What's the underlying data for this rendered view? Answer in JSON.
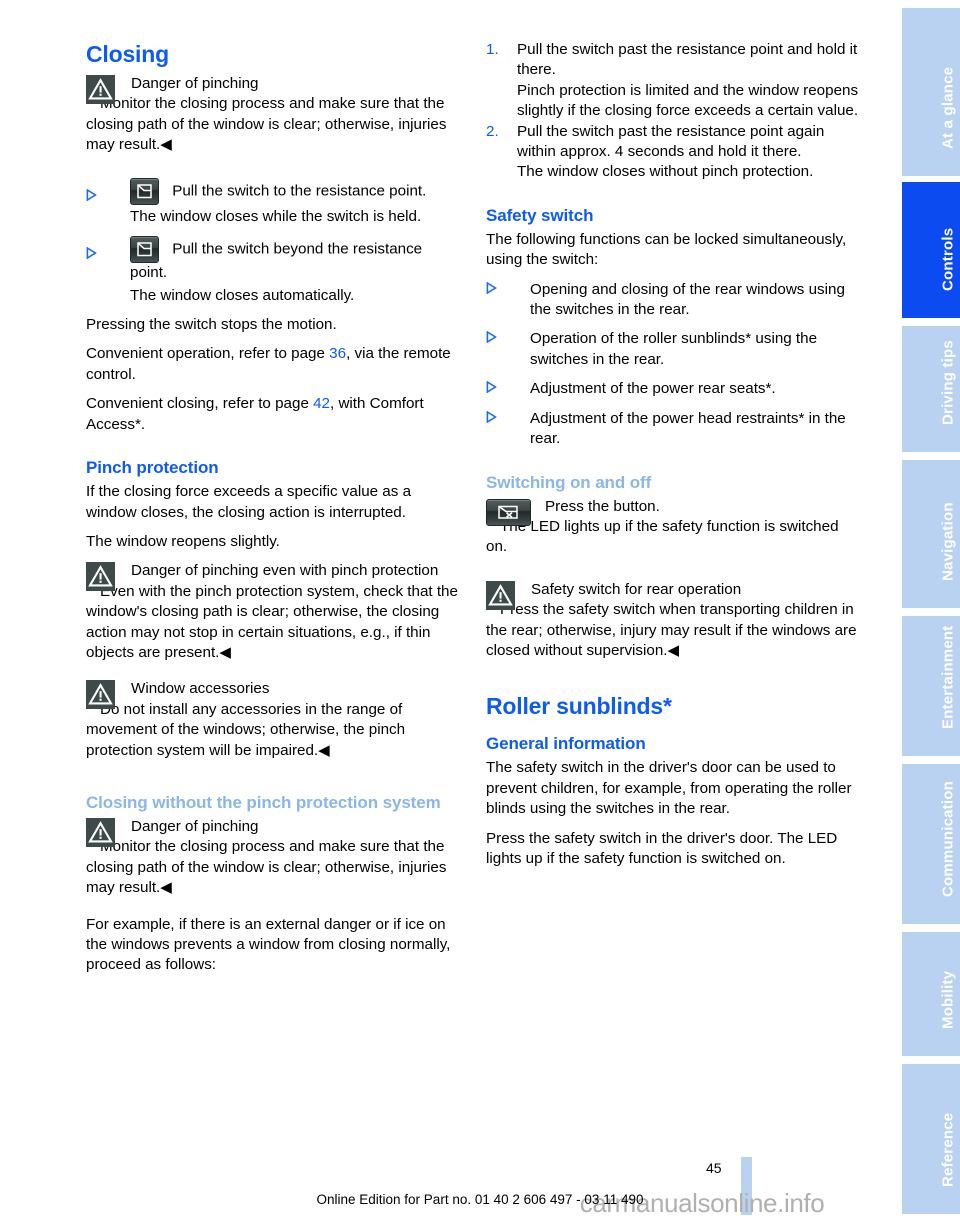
{
  "page": {
    "number": "45",
    "footer_text": "Online Edition for Part no. 01 40 2 606 497 - 03 11 490",
    "watermark": "carmanualsonline.info",
    "accent_blue": "#0c5bf5",
    "light_blue": "#8ab6e8",
    "tab_blue": "#b9d2f2",
    "tab_active_blue": "#0c4bf0"
  },
  "sidebar": {
    "tabs": [
      {
        "label": "At a glance",
        "active": false
      },
      {
        "label": "Controls",
        "active": true
      },
      {
        "label": "Driving tips",
        "active": false
      },
      {
        "label": "Navigation",
        "active": false
      },
      {
        "label": "Entertainment",
        "active": false
      },
      {
        "label": "Communication",
        "active": false
      },
      {
        "label": "Mobility",
        "active": false
      },
      {
        "label": "Reference",
        "active": false
      }
    ]
  },
  "left": {
    "closing": {
      "heading": "Closing",
      "warn1": {
        "icon": "warning-triangle-icon",
        "title": "Danger of pinching",
        "body": "Monitor the closing process and make sure that the closing path of the window is clear; otherwise, injuries may result.◀"
      },
      "step1": {
        "marker": "triangle-bullet-icon",
        "icon": "door-window-switch-icon",
        "text": "Pull the switch to the resistance point.",
        "result": "The window closes while the switch is held."
      },
      "step2": {
        "marker": "triangle-bullet-icon",
        "icon": "door-window-switch-icon",
        "text": "Pull the switch beyond the resistance point.",
        "result": "The window closes automatically."
      },
      "p_press": "Pressing the switch stops the motion.",
      "p_convenient_open_a": "Convenient operation, refer to page ",
      "p_convenient_open_ref": "36",
      "p_convenient_open_b": ", via the remote control.",
      "p_convenient_close_a": "Convenient closing, refer to page ",
      "p_convenient_close_ref": "42",
      "p_convenient_close_b": ", with Comfort Access*."
    },
    "pinch": {
      "heading": "Pinch protection",
      "p1": "If the closing force exceeds a specific value as a window closes, the closing action is interrupted.",
      "p2": "The window reopens slightly.",
      "warn": {
        "icon": "warning-triangle-icon",
        "title": "Danger of pinching even with pinch protection",
        "body": "Even with the pinch protection system, check that the window's closing path is clear; otherwise, the closing action may not stop in certain situations, e.g., if thin objects are present.◀"
      },
      "warn_accessories": {
        "icon": "warning-triangle-icon",
        "title": "Window accessories",
        "body": "Do not install any accessories in the range of movement of the windows; otherwise, the pinch protection system will be impaired.◀"
      }
    },
    "closing_without": {
      "heading": "Closing without the pinch protection system",
      "warn": {
        "icon": "warning-triangle-icon",
        "title": "Danger of pinching",
        "body": "Monitor the closing process and make sure that the closing path of the window is clear; otherwise, injuries may result.◀"
      },
      "p_example": "For example, if there is an external danger or if ice on the windows prevents a window from closing normally, proceed as follows:"
    }
  },
  "right": {
    "steps": [
      {
        "num": "1.",
        "text": "Pull the switch past the resistance point and hold it there.",
        "result": "Pinch protection is limited and the window reopens slightly if the closing force exceeds a certain value."
      },
      {
        "num": "2.",
        "text": "Pull the switch past the resistance point again within approx. 4 seconds and hold it there.",
        "result": "The window closes without pinch protection."
      }
    ],
    "safety_switch": {
      "heading": "Safety switch",
      "intro": "The following functions can be locked simultaneously, using the switch:",
      "bullets": [
        "Opening and closing of the rear windows using the switches in the rear.",
        "Operation of the roller sunblinds* using the switches in the rear.",
        "Adjustment of the power rear seats*.",
        "Adjustment of the power head restraints* in the rear."
      ]
    },
    "switching": {
      "heading": "Switching on and off",
      "icon": "safety-switch-button-icon",
      "press": "Press the button.",
      "led": "The LED lights up if the safety function is switched on.",
      "warn": {
        "icon": "warning-triangle-icon",
        "title": "Safety switch for rear operation",
        "body": "Press the safety switch when transporting children in the rear; otherwise, injury may result if the windows are closed without supervision.◀"
      }
    },
    "roller": {
      "heading": "Roller sunblinds*",
      "subheading": "General information",
      "p1": "The safety switch in the driver's door can be used to prevent children, for example, from operating the roller blinds using the switches in the rear.",
      "p2": "Press the safety switch in the driver's door. The LED lights up if the safety function is switched on."
    }
  }
}
